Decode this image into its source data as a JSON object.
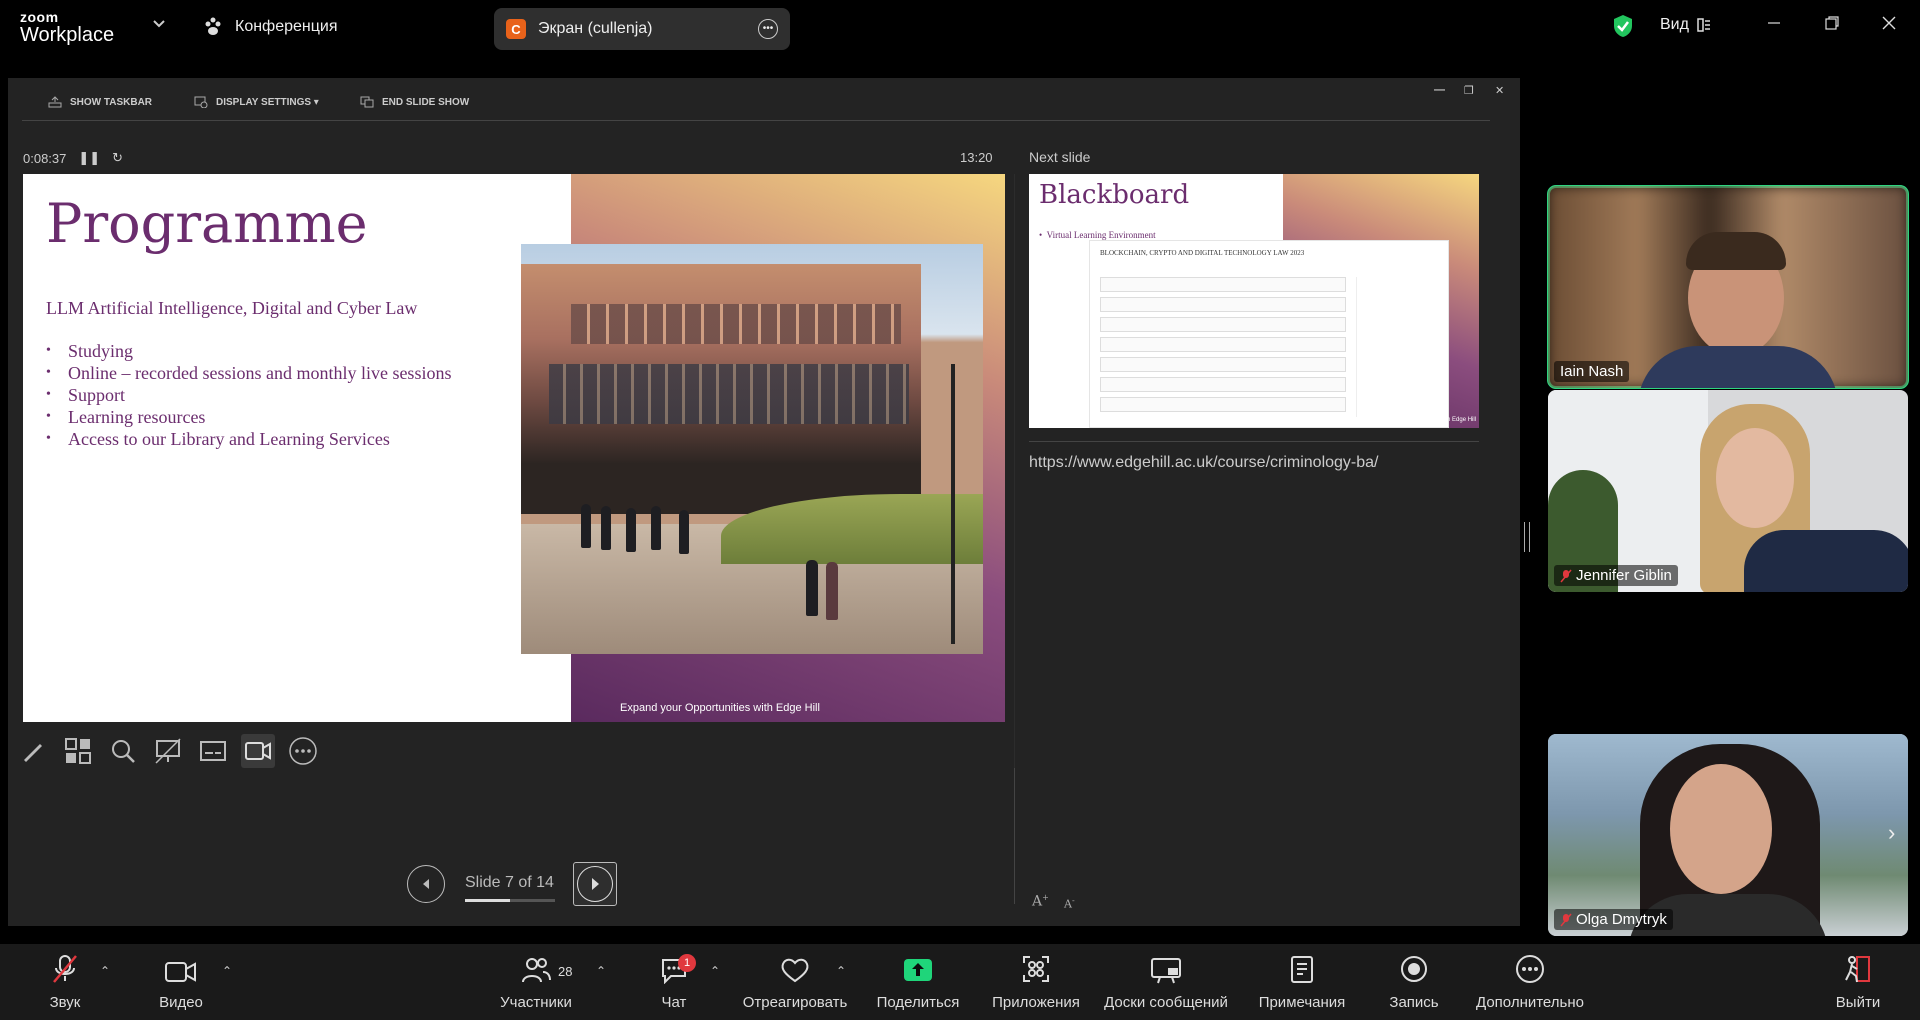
{
  "app": {
    "logo_line1": "zoom",
    "logo_line2": "Workplace",
    "meeting_name": "Конференция",
    "share_label": "Экран (cullenja)",
    "share_badge": "C",
    "view_label": "Вид"
  },
  "presenter": {
    "toolbar": {
      "show_taskbar": "SHOW TASKBAR",
      "display_settings": "DISPLAY SETTINGS ▾",
      "end_slide_show": "END SLIDE SHOW"
    },
    "elapsed": "0:08:37",
    "clock": "13:20",
    "current_slide": {
      "title": "Programme",
      "subtitle": "LLM Artificial Intelligence, Digital and Cyber Law",
      "bullets": [
        "Studying",
        "Online – recorded sessions and monthly live sessions",
        "Support",
        "Learning resources",
        "Access to our Library and Learning Services"
      ],
      "footer": "Expand your Opportunities with Edge Hill"
    },
    "slide_counter": "Slide 7 of 14",
    "slide_progress": 0.5,
    "next_label": "Next slide",
    "next_slide": {
      "title": "Blackboard",
      "bullet": "Virtual Learning Environment",
      "course_title": "BLOCKCHAIN, CRYPTO AND DIGITAL TECHNOLOGY LAW 2023",
      "footer": "Expand your Opportunities with Edge Hill"
    },
    "notes": "https://www.edgehill.ac.uk/course/criminology-ba/"
  },
  "participants": [
    {
      "name": "Iain Nash",
      "speaking": true,
      "muted": false
    },
    {
      "name": "Jennifer Giblin",
      "speaking": false,
      "muted": true
    },
    {
      "name": "Olga Dmytryk",
      "speaking": false,
      "muted": true
    }
  ],
  "bottom_toolbar": {
    "audio": "Звук",
    "video": "Видео",
    "participants": "Участники",
    "participants_count": "28",
    "chat": "Чат",
    "chat_badge": "1",
    "react": "Отреагировать",
    "share": "Поделиться",
    "apps": "Приложения",
    "whiteboards": "Доски сообщений",
    "notes": "Примечания",
    "record": "Запись",
    "more": "Дополнительно",
    "leave": "Выйти"
  },
  "colors": {
    "accent_green": "#2fd480",
    "share_green": "#1fd57a",
    "slide_purple": "#6b2d6e",
    "badge_red": "#e0383e"
  }
}
